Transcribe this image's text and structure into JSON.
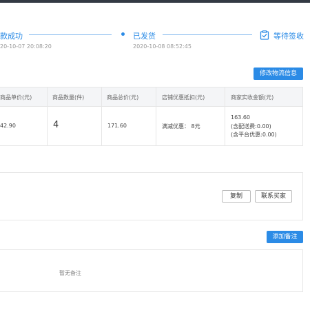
{
  "progress": {
    "steps": [
      {
        "label": "款成功",
        "time": "20-10-07 20:08:20"
      },
      {
        "label": "已发货",
        "time": "2020-10-08 08:52:45"
      },
      {
        "label": "等待签收"
      }
    ]
  },
  "logistics": {
    "modify_button": "修改物流信息"
  },
  "goods_table": {
    "headers": [
      "商品单价(元)",
      "商品数量(件)",
      "商品总价(元)",
      "店铺优惠抵扣(元)",
      "商家实收金额(元)"
    ],
    "row": {
      "unit_price": "42.90",
      "quantity": "4",
      "total_price": "171.60",
      "shop_discount": "满减优惠： 8元",
      "received_amount": "163.60",
      "received_shipping": "(含配送费:0.00)",
      "received_platform": "(含平台优惠:0.00)"
    }
  },
  "buyer_panel": {
    "copy_button": "复制",
    "contact_button": "联系买家"
  },
  "remark": {
    "add_button": "添加备注",
    "empty_text": "暂无备注"
  },
  "colors": {
    "accent": "#2b8be6",
    "border": "#e6e6e6",
    "header_bg": "#f4f5f7"
  }
}
